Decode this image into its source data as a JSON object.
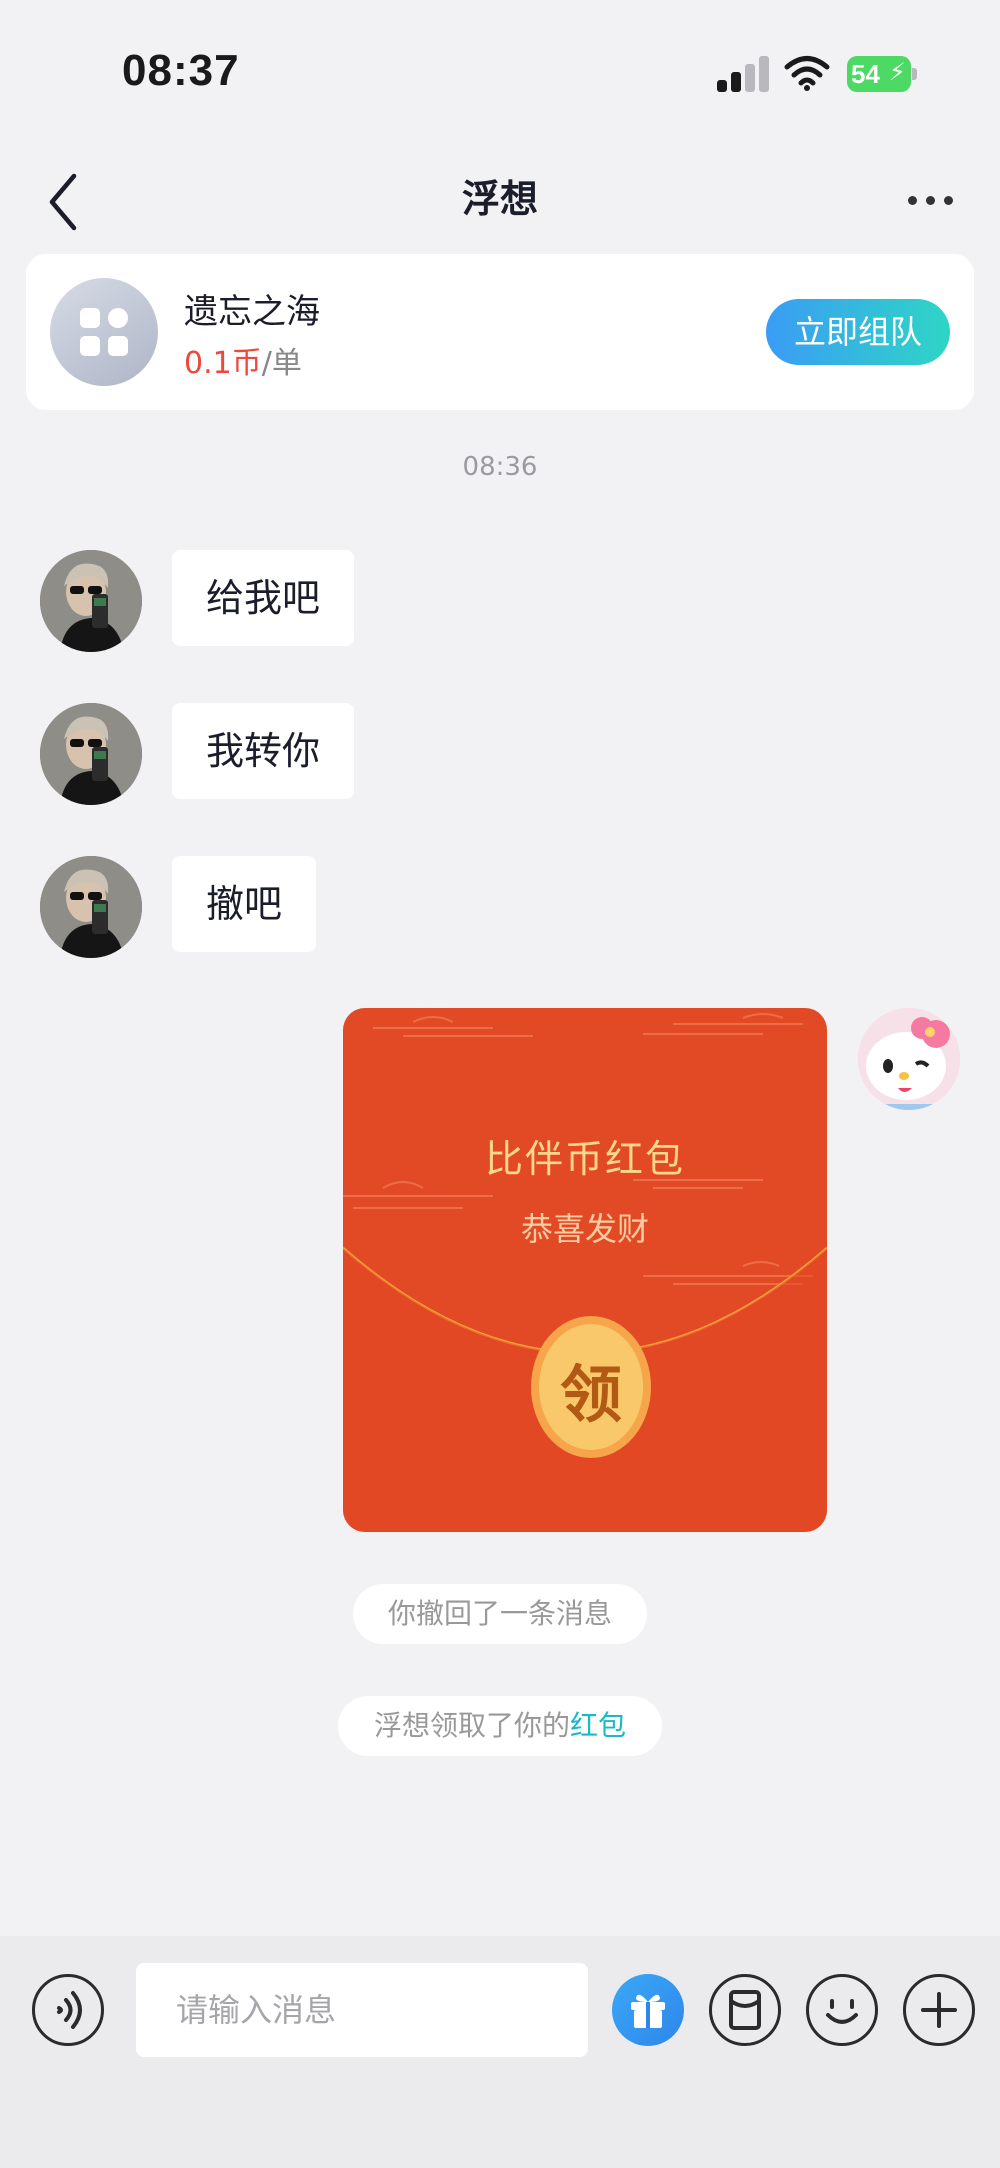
{
  "status_bar": {
    "time": "08:37",
    "battery": "54"
  },
  "nav": {
    "title": "浮想"
  },
  "game_card": {
    "name": "遗忘之海",
    "price_amount": "0.1币",
    "price_unit": "/单",
    "team_button": "立即组队"
  },
  "timestamp": "08:36",
  "messages": [
    {
      "text": "给我吧"
    },
    {
      "text": "我转你"
    },
    {
      "text": "撤吧"
    }
  ],
  "red_packet": {
    "title": "比伴币红包",
    "subtitle": "恭喜发财",
    "claim_label": "领"
  },
  "notices": {
    "recalled": "你撤回了一条消息",
    "received_prefix": "浮想领取了你的",
    "received_link": "红包"
  },
  "input": {
    "placeholder": "请输入消息"
  },
  "icons": [
    "signal-icon",
    "wifi-icon",
    "battery-icon",
    "back-arrow-icon",
    "more-icon",
    "game-grid-icon",
    "voice-icon",
    "gift-icon",
    "red-packet-icon",
    "emoji-icon",
    "plus-icon"
  ],
  "colors": {
    "accent_gradient_start": "#3a9cf5",
    "accent_gradient_end": "#2ed6c5",
    "price_red": "#f0473d",
    "red_packet": "#e24a25",
    "link": "#19b9c9"
  }
}
